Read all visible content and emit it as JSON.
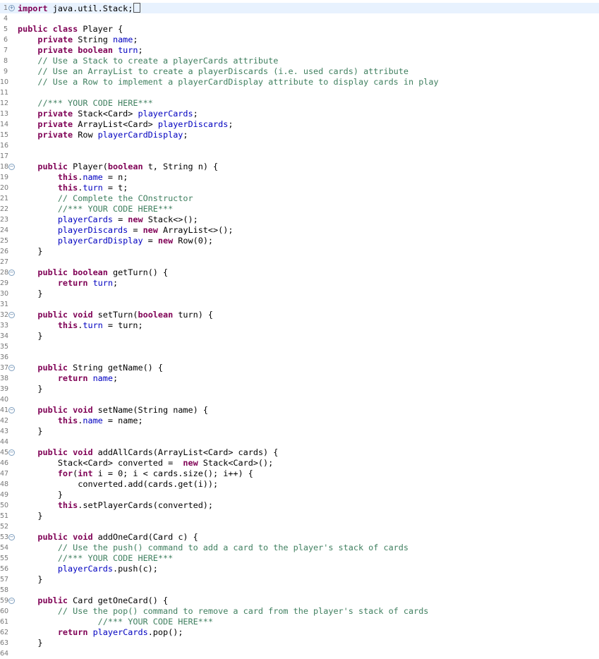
{
  "editor": {
    "language": "java",
    "lines": [
      {
        "n": "1",
        "fold": "plus",
        "indent": 0,
        "tokens": [
          [
            "kw",
            "import"
          ],
          [
            "pl",
            " java.util.Stack;"
          ]
        ],
        "cursor": true,
        "highlight": true
      },
      {
        "n": "4",
        "indent": 0,
        "tokens": []
      },
      {
        "n": "5",
        "indent": 0,
        "tokens": [
          [
            "kw",
            "public"
          ],
          [
            "pl",
            " "
          ],
          [
            "kw",
            "class"
          ],
          [
            "pl",
            " Player {"
          ]
        ]
      },
      {
        "n": "6",
        "indent": 1,
        "tokens": [
          [
            "kw",
            "private"
          ],
          [
            "pl",
            " String "
          ],
          [
            "fld",
            "name"
          ],
          [
            "pl",
            ";"
          ]
        ]
      },
      {
        "n": "7",
        "indent": 1,
        "tokens": [
          [
            "kw",
            "private"
          ],
          [
            "pl",
            " "
          ],
          [
            "kw",
            "boolean"
          ],
          [
            "pl",
            " "
          ],
          [
            "fld",
            "turn"
          ],
          [
            "pl",
            ";"
          ]
        ]
      },
      {
        "n": "8",
        "indent": 1,
        "tokens": [
          [
            "cm",
            "// Use a Stack to create a playerCards attribute"
          ]
        ]
      },
      {
        "n": "9",
        "indent": 1,
        "tokens": [
          [
            "cm",
            "// Use an ArrayList to create a playerDiscards (i.e. used cards) attribute"
          ]
        ]
      },
      {
        "n": "10",
        "indent": 1,
        "tokens": [
          [
            "cm",
            "// Use a Row to implement a playerCardDisplay attribute to display cards in play"
          ]
        ]
      },
      {
        "n": "11",
        "indent": 0,
        "tokens": []
      },
      {
        "n": "12",
        "indent": 1,
        "tokens": [
          [
            "cm",
            "//*** YOUR CODE HERE***"
          ]
        ]
      },
      {
        "n": "13",
        "indent": 1,
        "tokens": [
          [
            "kw",
            "private"
          ],
          [
            "pl",
            " Stack<Card> "
          ],
          [
            "fld",
            "playerCards"
          ],
          [
            "pl",
            ";"
          ]
        ]
      },
      {
        "n": "14",
        "indent": 1,
        "tokens": [
          [
            "kw",
            "private"
          ],
          [
            "pl",
            " ArrayList<Card> "
          ],
          [
            "fld",
            "playerDiscards"
          ],
          [
            "pl",
            ";"
          ]
        ]
      },
      {
        "n": "15",
        "indent": 1,
        "tokens": [
          [
            "kw",
            "private"
          ],
          [
            "pl",
            " Row "
          ],
          [
            "fld",
            "playerCardDisplay"
          ],
          [
            "pl",
            ";"
          ]
        ]
      },
      {
        "n": "16",
        "indent": 0,
        "tokens": []
      },
      {
        "n": "17",
        "indent": 0,
        "tokens": []
      },
      {
        "n": "18",
        "fold": "minus",
        "indent": 1,
        "tokens": [
          [
            "kw",
            "public"
          ],
          [
            "pl",
            " Player("
          ],
          [
            "kw",
            "boolean"
          ],
          [
            "pl",
            " t, String n) {"
          ]
        ]
      },
      {
        "n": "19",
        "indent": 2,
        "tokens": [
          [
            "kw",
            "this"
          ],
          [
            "pl",
            "."
          ],
          [
            "fld",
            "name"
          ],
          [
            "pl",
            " = n;"
          ]
        ]
      },
      {
        "n": "20",
        "indent": 2,
        "tokens": [
          [
            "kw",
            "this"
          ],
          [
            "pl",
            "."
          ],
          [
            "fld",
            "turn"
          ],
          [
            "pl",
            " = t;"
          ]
        ]
      },
      {
        "n": "21",
        "indent": 2,
        "tokens": [
          [
            "cm",
            "// Complete the COnstructor"
          ]
        ]
      },
      {
        "n": "22",
        "indent": 2,
        "tokens": [
          [
            "cm",
            "//*** YOUR CODE HERE***"
          ]
        ]
      },
      {
        "n": "23",
        "indent": 2,
        "tokens": [
          [
            "fld",
            "playerCards"
          ],
          [
            "pl",
            " = "
          ],
          [
            "kw",
            "new"
          ],
          [
            "pl",
            " Stack<>();"
          ]
        ]
      },
      {
        "n": "24",
        "indent": 2,
        "tokens": [
          [
            "fld",
            "playerDiscards"
          ],
          [
            "pl",
            " = "
          ],
          [
            "kw",
            "new"
          ],
          [
            "pl",
            " ArrayList<>();"
          ]
        ]
      },
      {
        "n": "25",
        "indent": 2,
        "tokens": [
          [
            "fld",
            "playerCardDisplay"
          ],
          [
            "pl",
            " = "
          ],
          [
            "kw",
            "new"
          ],
          [
            "pl",
            " Row(0);"
          ]
        ]
      },
      {
        "n": "26",
        "indent": 1,
        "tokens": [
          [
            "pl",
            "}"
          ]
        ]
      },
      {
        "n": "27",
        "indent": 0,
        "tokens": []
      },
      {
        "n": "28",
        "fold": "minus",
        "indent": 1,
        "tokens": [
          [
            "kw",
            "public"
          ],
          [
            "pl",
            " "
          ],
          [
            "kw",
            "boolean"
          ],
          [
            "pl",
            " getTurn() {"
          ]
        ]
      },
      {
        "n": "29",
        "indent": 2,
        "tokens": [
          [
            "kw",
            "return"
          ],
          [
            "pl",
            " "
          ],
          [
            "fld",
            "turn"
          ],
          [
            "pl",
            ";"
          ]
        ]
      },
      {
        "n": "30",
        "indent": 1,
        "tokens": [
          [
            "pl",
            "}"
          ]
        ]
      },
      {
        "n": "31",
        "indent": 0,
        "tokens": []
      },
      {
        "n": "32",
        "fold": "minus",
        "indent": 1,
        "tokens": [
          [
            "kw",
            "public"
          ],
          [
            "pl",
            " "
          ],
          [
            "kw",
            "void"
          ],
          [
            "pl",
            " setTurn("
          ],
          [
            "kw",
            "boolean"
          ],
          [
            "pl",
            " turn) {"
          ]
        ]
      },
      {
        "n": "33",
        "indent": 2,
        "tokens": [
          [
            "kw",
            "this"
          ],
          [
            "pl",
            "."
          ],
          [
            "fld",
            "turn"
          ],
          [
            "pl",
            " = turn;"
          ]
        ]
      },
      {
        "n": "34",
        "indent": 1,
        "tokens": [
          [
            "pl",
            "}"
          ]
        ]
      },
      {
        "n": "35",
        "indent": 0,
        "tokens": []
      },
      {
        "n": "36",
        "indent": 0,
        "tokens": []
      },
      {
        "n": "37",
        "fold": "minus",
        "indent": 1,
        "tokens": [
          [
            "kw",
            "public"
          ],
          [
            "pl",
            " String getName() {"
          ]
        ]
      },
      {
        "n": "38",
        "indent": 2,
        "tokens": [
          [
            "kw",
            "return"
          ],
          [
            "pl",
            " "
          ],
          [
            "fld",
            "name"
          ],
          [
            "pl",
            ";"
          ]
        ]
      },
      {
        "n": "39",
        "indent": 1,
        "tokens": [
          [
            "pl",
            "}"
          ]
        ]
      },
      {
        "n": "40",
        "indent": 0,
        "tokens": []
      },
      {
        "n": "41",
        "fold": "minus",
        "indent": 1,
        "tokens": [
          [
            "kw",
            "public"
          ],
          [
            "pl",
            " "
          ],
          [
            "kw",
            "void"
          ],
          [
            "pl",
            " setName(String name) {"
          ]
        ]
      },
      {
        "n": "42",
        "indent": 2,
        "tokens": [
          [
            "kw",
            "this"
          ],
          [
            "pl",
            "."
          ],
          [
            "fld",
            "name"
          ],
          [
            "pl",
            " = name;"
          ]
        ]
      },
      {
        "n": "43",
        "indent": 1,
        "tokens": [
          [
            "pl",
            "}"
          ]
        ]
      },
      {
        "n": "44",
        "indent": 0,
        "tokens": []
      },
      {
        "n": "45",
        "fold": "minus",
        "indent": 1,
        "tokens": [
          [
            "kw",
            "public"
          ],
          [
            "pl",
            " "
          ],
          [
            "kw",
            "void"
          ],
          [
            "pl",
            " addAllCards(ArrayList<Card> cards) {"
          ]
        ]
      },
      {
        "n": "46",
        "indent": 2,
        "tokens": [
          [
            "pl",
            "Stack<Card> converted =  "
          ],
          [
            "kw",
            "new"
          ],
          [
            "pl",
            " Stack<Card>();"
          ]
        ]
      },
      {
        "n": "47",
        "indent": 2,
        "tokens": [
          [
            "kw",
            "for"
          ],
          [
            "pl",
            "("
          ],
          [
            "kw",
            "int"
          ],
          [
            "pl",
            " i = 0; i < cards.size(); i++) {"
          ]
        ]
      },
      {
        "n": "48",
        "indent": 3,
        "tokens": [
          [
            "pl",
            "converted.add(cards.get(i));"
          ]
        ]
      },
      {
        "n": "49",
        "indent": 2,
        "tokens": [
          [
            "pl",
            "}"
          ]
        ]
      },
      {
        "n": "50",
        "indent": 2,
        "tokens": [
          [
            "kw",
            "this"
          ],
          [
            "pl",
            ".setPlayerCards(converted);"
          ]
        ]
      },
      {
        "n": "51",
        "indent": 1,
        "tokens": [
          [
            "pl",
            "}"
          ]
        ]
      },
      {
        "n": "52",
        "indent": 0,
        "tokens": []
      },
      {
        "n": "53",
        "fold": "minus",
        "indent": 1,
        "tokens": [
          [
            "kw",
            "public"
          ],
          [
            "pl",
            " "
          ],
          [
            "kw",
            "void"
          ],
          [
            "pl",
            " addOneCard(Card c) {"
          ]
        ]
      },
      {
        "n": "54",
        "indent": 2,
        "tokens": [
          [
            "cm",
            "// Use the push() command to add a card to the player's stack of cards"
          ]
        ]
      },
      {
        "n": "55",
        "indent": 2,
        "tokens": [
          [
            "cm",
            "//*** YOUR CODE HERE***"
          ]
        ]
      },
      {
        "n": "56",
        "indent": 2,
        "tokens": [
          [
            "fld",
            "playerCards"
          ],
          [
            "pl",
            ".push(c);"
          ]
        ]
      },
      {
        "n": "57",
        "indent": 1,
        "tokens": [
          [
            "pl",
            "}"
          ]
        ]
      },
      {
        "n": "58",
        "indent": 0,
        "tokens": []
      },
      {
        "n": "59",
        "fold": "minus",
        "indent": 1,
        "tokens": [
          [
            "kw",
            "public"
          ],
          [
            "pl",
            " Card getOneCard() {"
          ]
        ]
      },
      {
        "n": "60",
        "indent": 2,
        "tokens": [
          [
            "cm",
            "// Use the pop() command to remove a card from the player's stack of cards"
          ]
        ]
      },
      {
        "n": "61",
        "indent": 4,
        "tokens": [
          [
            "cm",
            "//*** YOUR CODE HERE***"
          ]
        ]
      },
      {
        "n": "62",
        "indent": 2,
        "tokens": [
          [
            "kw",
            "return"
          ],
          [
            "pl",
            " "
          ],
          [
            "fld",
            "playerCards"
          ],
          [
            "pl",
            ".pop();"
          ]
        ]
      },
      {
        "n": "63",
        "indent": 1,
        "tokens": [
          [
            "pl",
            "}"
          ]
        ]
      },
      {
        "n": "64",
        "indent": 0,
        "tokens": []
      }
    ]
  },
  "colors": {
    "keyword": "#7f0055",
    "field": "#0000c0",
    "comment": "#3f7f5f",
    "line_number": "#787878"
  },
  "icons": {
    "fold_expand": "plus-circle-icon",
    "fold_collapse": "minus-circle-icon"
  }
}
